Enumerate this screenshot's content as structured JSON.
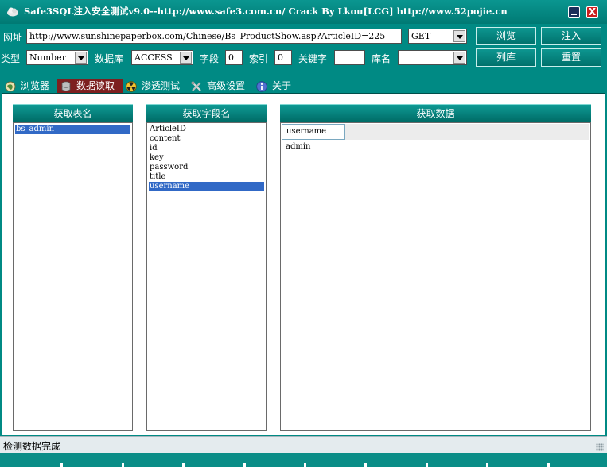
{
  "window": {
    "title": "Safe3SQL注入安全测试v9.0--http://www.safe3.com.cn/   Crack By Lkou[LCG]  http://www.52pojie.cn",
    "close_label": "X"
  },
  "form": {
    "url_label": "网址",
    "url_value": "http://www.sunshinepaperbox.com/Chinese/Bs_ProductShow.asp?ArticleID=225",
    "method_value": "GET",
    "type_label": "类型",
    "type_value": "Number",
    "db_label": "数据库",
    "db_value": "ACCESS",
    "field_label": "字段",
    "field_value": "0",
    "index_label": "索引",
    "index_value": "0",
    "keyword_label": "关键字",
    "keyword_value": "",
    "dbname_label": "库名",
    "dbname_value": ""
  },
  "buttons": {
    "browse": "浏览",
    "inject": "注入",
    "list_db": "列库",
    "reset": "重置"
  },
  "tabs": [
    {
      "label": "浏览器",
      "icon": "globe-icon"
    },
    {
      "label": "数据读取",
      "icon": "database-icon"
    },
    {
      "label": "渗透测试",
      "icon": "radiation-icon"
    },
    {
      "label": "高级设置",
      "icon": "tools-icon"
    },
    {
      "label": "关于",
      "icon": "info-icon"
    }
  ],
  "active_tab": "数据读取",
  "tables": {
    "header": "获取表名",
    "items": [
      "bs_admin"
    ],
    "selected": "bs_admin"
  },
  "fields": {
    "header": "获取字段名",
    "items": [
      "ArticleID",
      "content",
      "id",
      "key",
      "password",
      "title",
      "username"
    ],
    "selected": "username"
  },
  "data": {
    "header": "获取数据",
    "columns": [
      "username"
    ],
    "rows": [
      [
        "admin"
      ]
    ]
  },
  "status": {
    "text": "检测数据完成"
  },
  "colors": {
    "teal": "#008a84",
    "selection": "#3169c6",
    "active_tab": "#7d1f1f"
  }
}
